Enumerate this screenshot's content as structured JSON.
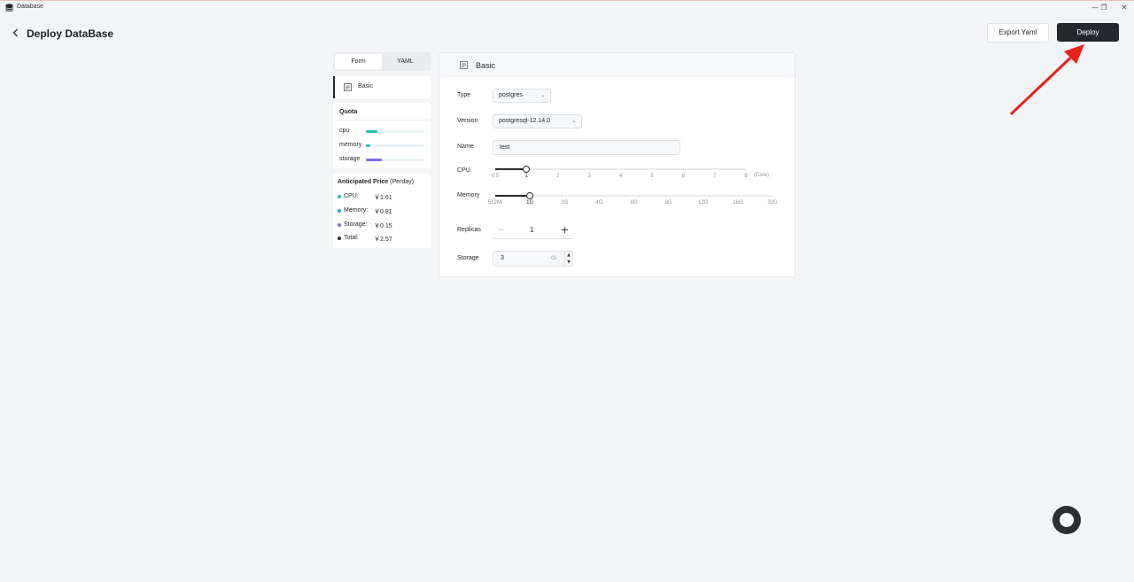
{
  "window": {
    "title": "Database",
    "minimize": "—",
    "restore": "❐",
    "close": "✕"
  },
  "header": {
    "title": "Deploy DataBase",
    "export_label": "Export Yaml",
    "deploy_label": "Deploy"
  },
  "tabs": [
    {
      "label": "Form",
      "active": true
    },
    {
      "label": "YAML",
      "active": false
    }
  ],
  "nav": {
    "basic_label": "Basic"
  },
  "quota": {
    "title": "Quota",
    "items": [
      {
        "label": "cpu",
        "fraction": 0.2,
        "color": "#1bc4b8"
      },
      {
        "label": "memory",
        "fraction": 0.08,
        "color": "#1bc4b8"
      },
      {
        "label": "storage",
        "fraction": 0.28,
        "color": "#7b6cf0"
      }
    ]
  },
  "price": {
    "title_bold": "Anticipated Price",
    "title_suffix": "(Perday)",
    "items": [
      {
        "label": "CPU:",
        "value": "￥1.61",
        "color": "#1bc4b8"
      },
      {
        "label": "Memory:",
        "value": "￥0.81",
        "color": "#1ba7c4"
      },
      {
        "label": "Storage:",
        "value": "￥0.15",
        "color": "#7b6cf0"
      },
      {
        "label": "Total:",
        "value": "￥2.57",
        "color": "#24282c"
      }
    ]
  },
  "form": {
    "section_title": "Basic",
    "type": {
      "label": "Type",
      "value": "postgres"
    },
    "version": {
      "label": "Version",
      "value": "postgresql-12.14.0"
    },
    "name": {
      "label": "Name",
      "value": "test"
    },
    "cpu": {
      "label": "CPU",
      "marks": [
        "0.5",
        "1",
        "2",
        "3",
        "4",
        "5",
        "6",
        "7",
        "8"
      ],
      "selected_index": 1,
      "unit": "(Core)"
    },
    "memory": {
      "label": "Memory",
      "marks": [
        "512Mi",
        "1G",
        "2G",
        "4G",
        "6G",
        "8G",
        "12G",
        "16G",
        "32G"
      ],
      "selected_index": 1
    },
    "replicas": {
      "label": "Replicas",
      "value": "1",
      "minus": "−",
      "plus": "+"
    },
    "storage": {
      "label": "Storage",
      "value": "3",
      "unit": "Gi",
      "up": "▲",
      "down": "▼"
    }
  }
}
